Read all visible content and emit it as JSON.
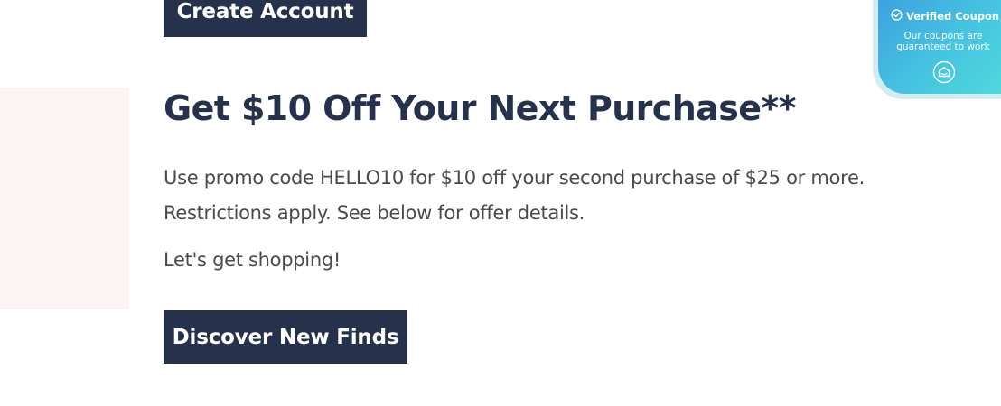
{
  "actions": {
    "create_account_label": "Create Account",
    "discover_label": "Discover New Finds"
  },
  "offer": {
    "heading": "Get $10 Off Your Next Purchase**",
    "promo_text": "Use promo code HELLO10 for $10 off your second purchase of $25 or more. Restrictions apply. See below for offer details.",
    "cta_text": "Let's get shopping!"
  },
  "coupon_badge": {
    "title": "Verified Coupon",
    "subtitle": "Our coupons are guaranteed to work",
    "check_icon": "check-circle-icon",
    "logo_icon": "coupon-brand-logo-icon"
  },
  "colors": {
    "primary_navy": "#26324b",
    "body_text": "#4a4a4a",
    "accent_pink_bg": "#fcf3f3",
    "badge_gradient_start": "#3b9ae0",
    "badge_gradient_end": "#50dcdc"
  }
}
